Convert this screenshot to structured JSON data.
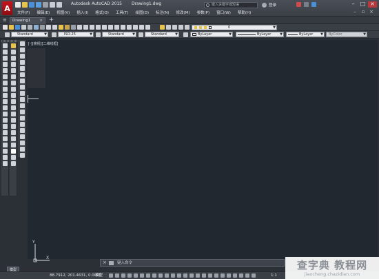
{
  "app": {
    "title": "Autodesk AutoCAD 2015",
    "filename": "Drawing1.dwg",
    "logo_letter": "A"
  },
  "menu": [
    "文件(F)",
    "编辑(E)",
    "视图(V)",
    "插入(I)",
    "格式(O)",
    "工具(T)",
    "绘图(D)",
    "标注(N)",
    "修改(M)",
    "参数(P)",
    "窗口(W)",
    "帮助(H)"
  ],
  "search": {
    "placeholder": "键入关键字或短语"
  },
  "account": {
    "login_label": "登录"
  },
  "tabs": {
    "document": "Drawing1",
    "close": "×",
    "add": "+"
  },
  "layer": {
    "current": "0"
  },
  "properties": {
    "text_style": "Standard",
    "dim_style": "ISO-25",
    "table_style": "Standard",
    "multileader_style": "Standard",
    "color": "ByLayer",
    "linetype": "ByLayer",
    "lineweight": "ByLayer",
    "plot_style": "ByColor"
  },
  "viewport": {
    "label": "[-][俯视][二维线框]"
  },
  "ucs": {
    "x_label": "X",
    "y_label": "Y"
  },
  "command": {
    "prompt": "键入命令"
  },
  "model_tabs": {
    "model": "模型"
  },
  "status": {
    "coordinates": "88.7912, 201.4631, 0.0000",
    "model": "模型",
    "scale": "1:1"
  },
  "watermark": {
    "main": "查字典 教程网",
    "sub": "jiaocheng.chazidian.com"
  },
  "colors": {
    "logo": "#c4161c",
    "canvas": "#212830",
    "chrome": "#3a3e45",
    "accent_blue": "#4a90d9",
    "accent_yellow": "#e6c34a"
  }
}
